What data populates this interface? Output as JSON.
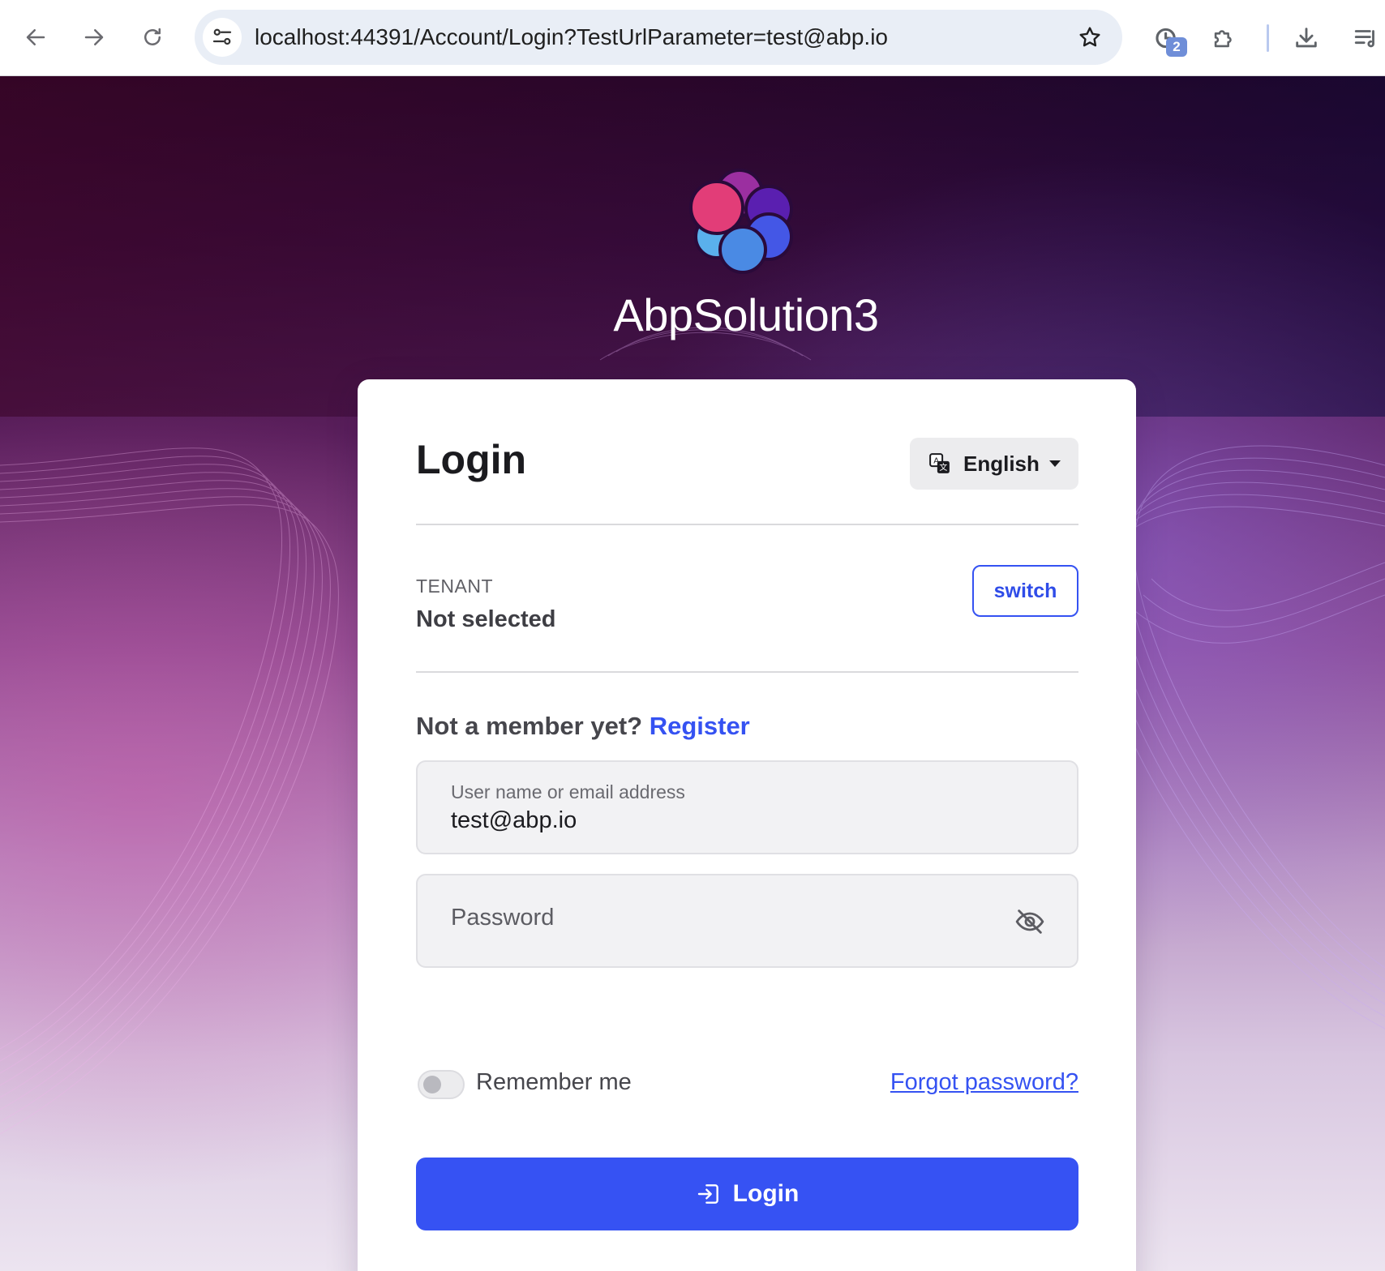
{
  "browser": {
    "url": "localhost:44391/Account/Login?TestUrlParameter=test@abp.io",
    "extension_badge": "2"
  },
  "brand": {
    "app_name": "AbpSolution3",
    "logo_colors": [
      "#e23d78",
      "#9b2fa0",
      "#5a1fb0",
      "#4457e6",
      "#4a8ae4",
      "#5ab0ec"
    ]
  },
  "login_card": {
    "title": "Login",
    "language": {
      "selected": "English"
    },
    "tenant": {
      "label": "TENANT",
      "value": "Not selected",
      "switch_label": "switch"
    },
    "register": {
      "prompt": "Not a member yet?",
      "link_label": "Register"
    },
    "username_field": {
      "label": "User name or email address",
      "value": "test@abp.io"
    },
    "password_field": {
      "placeholder": "Password",
      "value": ""
    },
    "remember_me": {
      "label": "Remember me",
      "checked": false
    },
    "forgot_password_label": "Forgot password?",
    "submit_label": "Login"
  },
  "colors": {
    "accent": "#3652f3",
    "link": "#3552f2"
  }
}
